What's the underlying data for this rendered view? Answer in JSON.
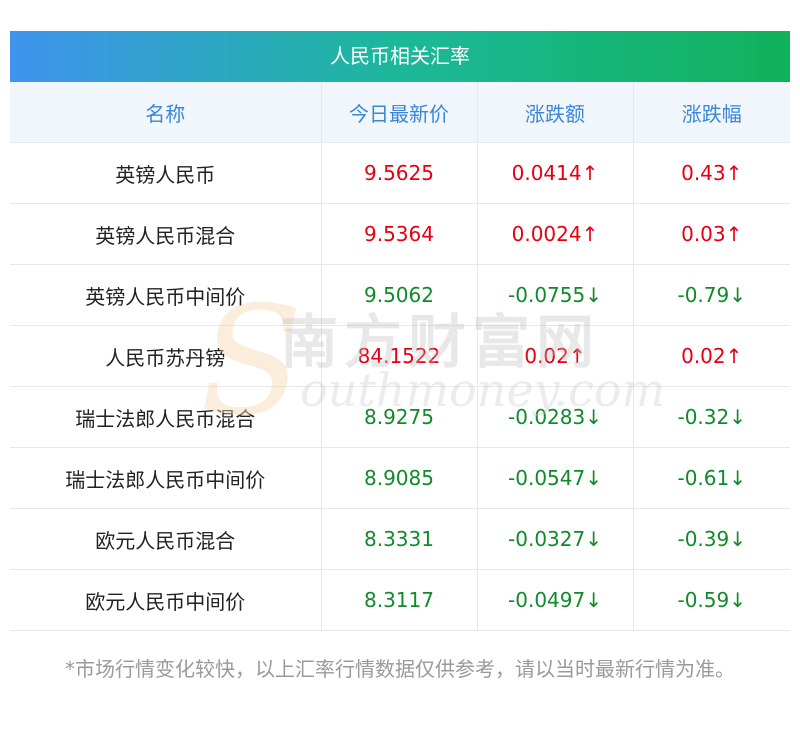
{
  "header": {
    "title": "人民币相关汇率"
  },
  "columns": [
    "名称",
    "今日最新价",
    "涨跌额",
    "涨跌幅"
  ],
  "rows": [
    {
      "name": "英镑人民币",
      "price": "9.5625",
      "change": "0.0414↑",
      "pct": "0.43↑",
      "dir": "up"
    },
    {
      "name": "英镑人民币混合",
      "price": "9.5364",
      "change": "0.0024↑",
      "pct": "0.03↑",
      "dir": "up"
    },
    {
      "name": "英镑人民币中间价",
      "price": "9.5062",
      "change": "-0.0755↓",
      "pct": "-0.79↓",
      "dir": "down"
    },
    {
      "name": "人民币苏丹镑",
      "price": "84.1522",
      "change": "0.02↑",
      "pct": "0.02↑",
      "dir": "up"
    },
    {
      "name": "瑞士法郎人民币混合",
      "price": "8.9275",
      "change": "-0.0283↓",
      "pct": "-0.32↓",
      "dir": "down"
    },
    {
      "name": "瑞士法郎人民币中间价",
      "price": "8.9085",
      "change": "-0.0547↓",
      "pct": "-0.61↓",
      "dir": "down"
    },
    {
      "name": "欧元人民币混合",
      "price": "8.3331",
      "change": "-0.0327↓",
      "pct": "-0.39↓",
      "dir": "down"
    },
    {
      "name": "欧元人民币中间价",
      "price": "8.3117",
      "change": "-0.0497↓",
      "pct": "-0.59↓",
      "dir": "down"
    }
  ],
  "footnote": "*市场行情变化较快，以上汇率行情数据仅供参考，请以当时最新行情为准。",
  "watermark": {
    "logo_letter": "S",
    "cn": "南方财富网",
    "en": "outhmoney.com"
  },
  "colors": {
    "up": "#e60012",
    "down": "#118a2b",
    "header_text": "#3a86d8",
    "title_gradient_start": "#3f93ee",
    "title_gradient_end": "#10b25a"
  }
}
